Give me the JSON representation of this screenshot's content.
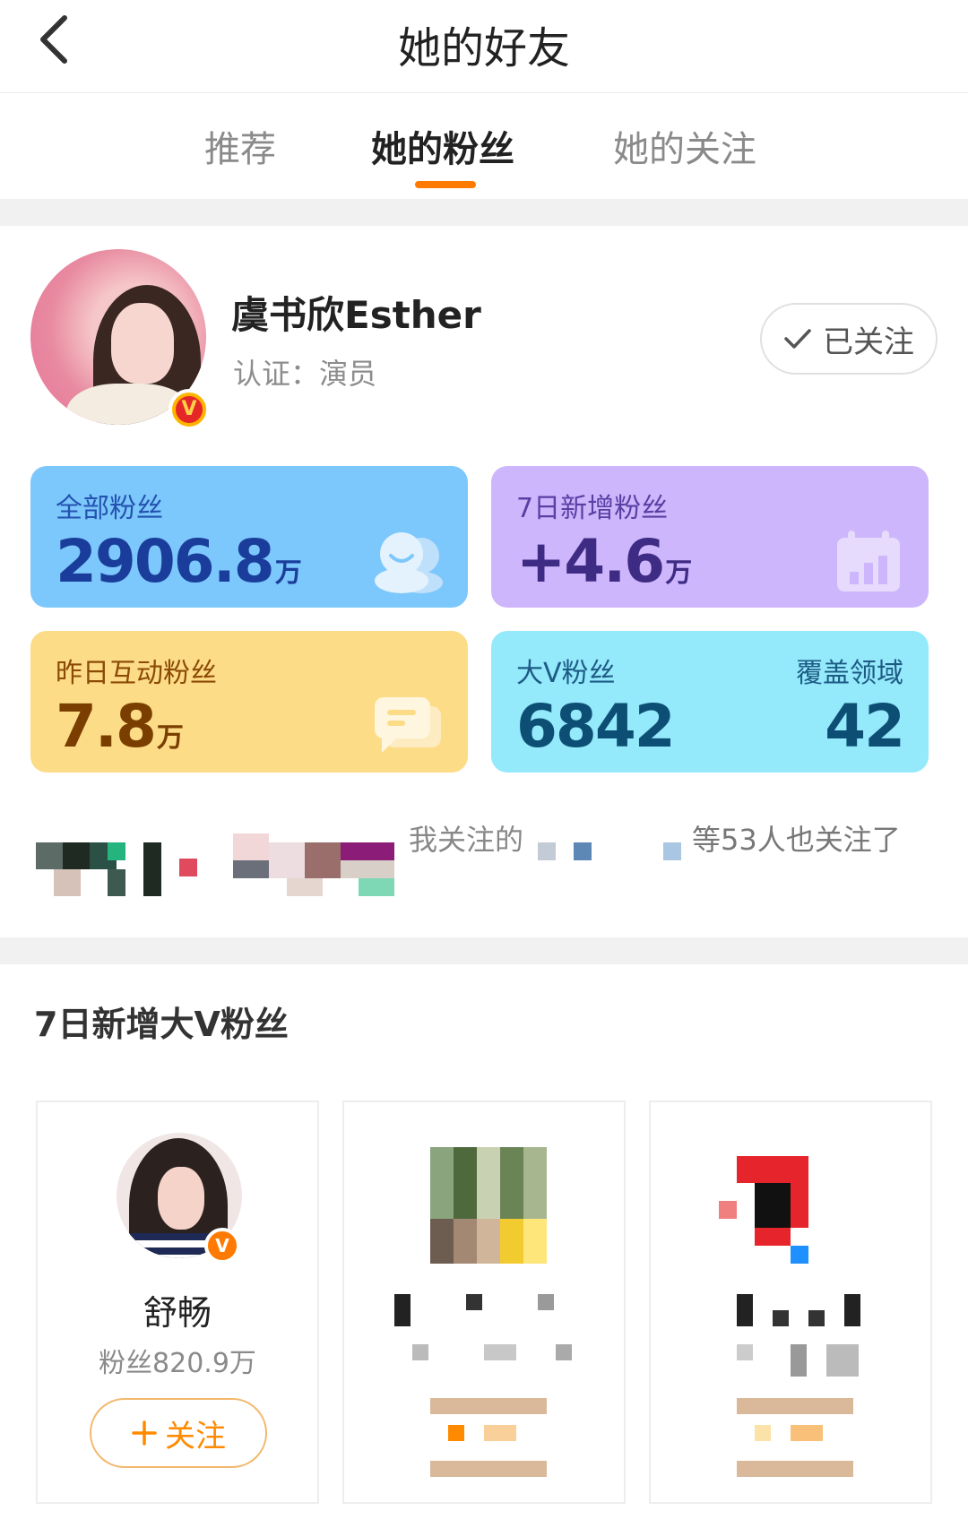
{
  "header": {
    "title": "她的好友",
    "back_icon": "chevron-left-icon"
  },
  "tabs": [
    {
      "label": "推荐",
      "active": false
    },
    {
      "label": "她的粉丝",
      "active": true
    },
    {
      "label": "她的关注",
      "active": false
    }
  ],
  "colors": {
    "accent": "#ff7a00",
    "blue_card": "#7cc7fb",
    "purple_card": "#cdb6fb",
    "yellow_card": "#fddc87",
    "cyan_card": "#94e9fb"
  },
  "profile": {
    "name": "虞书欣Esther",
    "verification": "认证：演员",
    "follow_status": "已关注",
    "follow_icon": "check-icon",
    "badge": "V"
  },
  "stats": {
    "total_fans": {
      "label": "全部粉丝",
      "value": "2906.8",
      "unit": "万",
      "icon": "smile-people-icon"
    },
    "new_fans_7d": {
      "label": "7日新增粉丝",
      "value": "+4.6",
      "unit": "万",
      "icon": "calendar-chart-icon"
    },
    "interactive_yesterday": {
      "label": "昨日互动粉丝",
      "value": "7.8",
      "unit": "万",
      "icon": "chat-bubble-icon"
    },
    "big_v": {
      "label": "大V粉丝",
      "value": "6842",
      "right_label": "覆盖领域",
      "right_value": "42"
    }
  },
  "mutual": {
    "prefix": "我关注的",
    "suffix": "等53人也关注了"
  },
  "section": {
    "title": "7日新增大V粉丝"
  },
  "fans": [
    {
      "name": "舒畅",
      "count": "粉丝820.9万",
      "follow_label": "关注",
      "badge": "V"
    }
  ]
}
